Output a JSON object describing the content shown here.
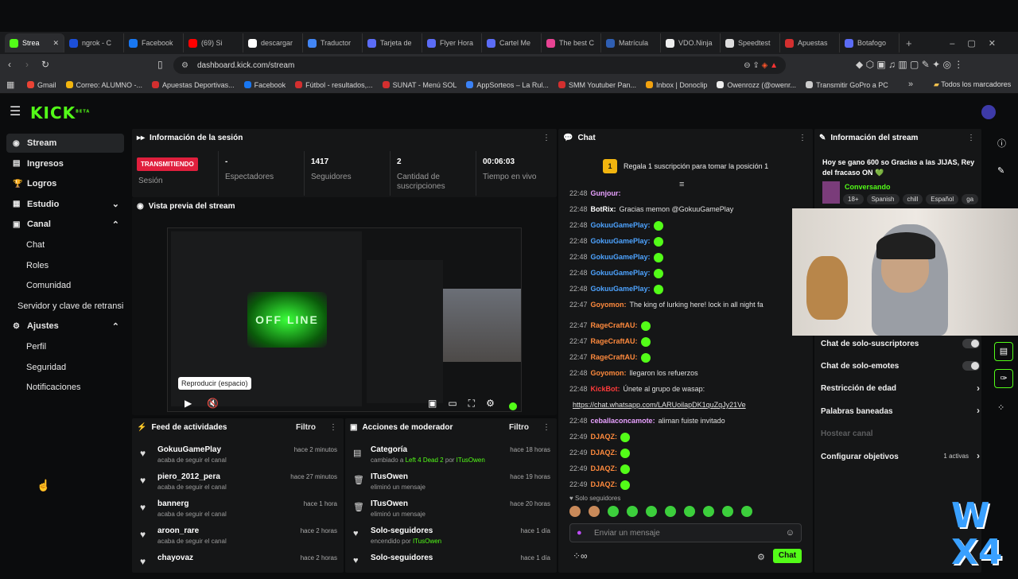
{
  "browser": {
    "tabs": [
      {
        "label": "Strea",
        "color": "#53fc18",
        "active": true
      },
      {
        "label": "ngrok - C",
        "color": "#1c4fd8"
      },
      {
        "label": "Facebook",
        "color": "#1877f2"
      },
      {
        "label": "(69) Si",
        "color": "#ff0000"
      },
      {
        "label": "descargar",
        "color": "#ffffff"
      },
      {
        "label": "Traductor",
        "color": "#4285f4"
      },
      {
        "label": "Tarjeta de",
        "color": "#5b6cf6"
      },
      {
        "label": "Flyer Hora",
        "color": "#5b6cf6"
      },
      {
        "label": "Cartel Me",
        "color": "#5b6cf6"
      },
      {
        "label": "The best C",
        "color": "#e84393"
      },
      {
        "label": "Matrícula",
        "color": "#2f5fb3"
      },
      {
        "label": "VDO.Ninja",
        "color": "#eeeeee"
      },
      {
        "label": "Speedtest",
        "color": "#dddddd"
      },
      {
        "label": "Apuestas",
        "color": "#d32f2f"
      },
      {
        "label": "Botafogo",
        "color": "#5b6cf6"
      }
    ],
    "url": "dashboard.kick.com/stream",
    "bookmarks": [
      {
        "label": "Gmail",
        "color": "#ea4335"
      },
      {
        "label": "Correo: ALUMNO -...",
        "color": "#f2b50f"
      },
      {
        "label": "Apuestas Deportivas...",
        "color": "#d32f2f"
      },
      {
        "label": "Facebook",
        "color": "#1877f2"
      },
      {
        "label": "Fútbol - resultados,...",
        "color": "#d32f2f"
      },
      {
        "label": "SUNAT - Menú SOL",
        "color": "#d32f2f"
      },
      {
        "label": "AppSorteos – La Rul...",
        "color": "#3b82f6"
      },
      {
        "label": "SMM Youtuber Pan...",
        "color": "#d32f2f"
      },
      {
        "label": "Inbox | Donoclip",
        "color": "#f2a20f"
      },
      {
        "label": "Owenrozz (@owenr...",
        "color": "#eeeeee"
      },
      {
        "label": "Transmitir GoPro a PC",
        "color": "#cccccc"
      }
    ],
    "bookmarks_all": "Todos los marcadores"
  },
  "kick": {
    "logo": "KICK",
    "beta": "BETA"
  },
  "sidebar": {
    "items": [
      {
        "label": "Stream",
        "icon": "stream-icon",
        "active": true
      },
      {
        "label": "Ingresos",
        "icon": "wallet-icon"
      },
      {
        "label": "Logros",
        "icon": "trophy-icon"
      },
      {
        "label": "Estudio",
        "icon": "studio-icon",
        "chev": "⌄"
      },
      {
        "label": "Canal",
        "icon": "channel-icon",
        "chev": "⌃"
      },
      {
        "label": "Chat",
        "sub": true
      },
      {
        "label": "Roles",
        "sub": true
      },
      {
        "label": "Comunidad",
        "sub": true
      },
      {
        "label": "Servidor y clave de retransi",
        "sub": true
      },
      {
        "label": "Ajustes",
        "icon": "gear-icon",
        "chev": "⌃"
      },
      {
        "label": "Perfil",
        "sub": true
      },
      {
        "label": "Seguridad",
        "sub": true
      },
      {
        "label": "Notificaciones",
        "sub": true
      }
    ]
  },
  "session": {
    "title": "Información de la sesión",
    "status": "TRANSMITIENDO",
    "status_label": "Sesión",
    "stats": [
      {
        "value": "-",
        "label": "Espectadores"
      },
      {
        "value": "1417",
        "label": "Seguidores"
      },
      {
        "value": "2",
        "label": "Cantidad de suscripciones"
      },
      {
        "value": "00:06:03",
        "label": "Tiempo en vivo"
      }
    ]
  },
  "preview": {
    "title": "Vista previa del stream",
    "tooltip": "Reproducir (espacio)",
    "offline": "OFF LINE"
  },
  "feed": {
    "title": "Feed de actividades",
    "filter": "Filtro",
    "rows": [
      {
        "name": "GokuuGamePlay",
        "sub": "acaba de seguir el canal",
        "time": "hace 2 minutos"
      },
      {
        "name": "piero_2012_pera",
        "sub": "acaba de seguir el canal",
        "time": "hace 27 minutos"
      },
      {
        "name": "bannerg",
        "sub": "acaba de seguir el canal",
        "time": "hace 1 hora"
      },
      {
        "name": "aroon_rare",
        "sub": "acaba de seguir el canal",
        "time": "hace 2 horas"
      },
      {
        "name": "chayovaz",
        "sub": "",
        "time": "hace 2 horas"
      }
    ]
  },
  "mod": {
    "title": "Acciones de moderador",
    "filter": "Filtro",
    "rows": [
      {
        "name": "Categoría",
        "sub": "cambiado a",
        "game": "Left 4 Dead 2",
        "by": "por",
        "user": "ITusOwen",
        "time": "hace 18 horas"
      },
      {
        "name": "ITusOwen",
        "sub": "eliminó un mensaje",
        "time": "hace 19 horas"
      },
      {
        "name": "ITusOwen",
        "sub": "eliminó un mensaje",
        "time": "hace 20 horas"
      },
      {
        "name": "Solo-seguidores",
        "sub": "encendido por",
        "user": "ITusOwen",
        "time": "hace 1 día"
      },
      {
        "name": "Solo-seguidores",
        "sub": "",
        "time": "hace 1 día"
      }
    ]
  },
  "chat": {
    "title": "Chat",
    "pinned": "Regala 1 suscripción para tomar la posición 1",
    "pinned_rank": "1",
    "messages": [
      {
        "time": "22:48",
        "user": "Gunjour:",
        "color": "#e8a1ff",
        "text": "",
        "emotes": 0
      },
      {
        "time": "22:48",
        "user": "BotRix:",
        "color": "#ffffff",
        "text": "Gracias memon @GokuuGamePlay",
        "emotes": 0
      },
      {
        "time": "22:48",
        "user": "GokuuGamePlay:",
        "color": "#4da3ff",
        "text": "",
        "emotes": 1
      },
      {
        "time": "22:48",
        "user": "GokuuGamePlay:",
        "color": "#4da3ff",
        "text": "",
        "emotes": 1
      },
      {
        "time": "22:48",
        "user": "GokuuGamePlay:",
        "color": "#4da3ff",
        "text": "",
        "emotes": 1
      },
      {
        "time": "22:48",
        "user": "GokuuGamePlay:",
        "color": "#4da3ff",
        "text": "",
        "emotes": 1
      },
      {
        "time": "22:48",
        "user": "GokuuGamePlay:",
        "color": "#4da3ff",
        "text": "",
        "emotes": 1
      },
      {
        "time": "22:47",
        "user": "Goyomon:",
        "color": "#ff8a3d",
        "text": "The king of lurking here! lock in all night fa",
        "emotes": 0
      },
      {
        "time": "22:47",
        "user": "RageCraftAU:",
        "color": "#ff8a3d",
        "text": "",
        "emotes": 1
      },
      {
        "time": "22:47",
        "user": "RageCraftAU:",
        "color": "#ff8a3d",
        "text": "",
        "emotes": 1
      },
      {
        "time": "22:47",
        "user": "RageCraftAU:",
        "color": "#ff8a3d",
        "text": "",
        "emotes": 1
      },
      {
        "time": "22:48",
        "user": "Goyomon:",
        "color": "#ff8a3d",
        "text": "llegaron los refuerzos",
        "emotes": 0
      },
      {
        "time": "22:48",
        "user": "KickBot:",
        "color": "#ff3b3b",
        "text": "Únete al grupo de wasap:",
        "emotes": 0
      },
      {
        "time": "",
        "user": "",
        "color": "#ffffff",
        "text": "https://chat.whatsapp.com/LARUoilapDK1quZqJy21Ve",
        "emotes": 0
      },
      {
        "time": "22:48",
        "user": "ceballaconcamote:",
        "color": "#e8a1ff",
        "text": "aliman fuiste invitado",
        "emotes": 0
      },
      {
        "time": "22:49",
        "user": "DJAQZ:",
        "color": "#ff8a3d",
        "text": "",
        "emotes": 1
      },
      {
        "time": "22:49",
        "user": "DJAQZ:",
        "color": "#ff8a3d",
        "text": "",
        "emotes": 1
      },
      {
        "time": "22:49",
        "user": "DJAQZ:",
        "color": "#ff8a3d",
        "text": "",
        "emotes": 1
      },
      {
        "time": "22:49",
        "user": "DJAQZ:",
        "color": "#ff8a3d",
        "text": "",
        "emotes": 1
      }
    ],
    "followers_only": "Solo seguidores",
    "placeholder": "Enviar un mensaje",
    "send": "Chat"
  },
  "info": {
    "title": "Información del stream",
    "stream_title": "Hoy se gano 600 so Gracias a las JIJAS, Rey del fracaso ON 💚",
    "category": "Conversando",
    "tags": [
      "18+",
      "Spanish",
      "chill",
      "Español",
      "ga"
    ],
    "settings": [
      {
        "label": "Chat de solo-suscriptores",
        "kind": "toggle"
      },
      {
        "label": "Chat de solo-emotes",
        "kind": "toggle"
      },
      {
        "label": "Restricción de edad",
        "kind": "chev"
      },
      {
        "label": "Palabras baneadas",
        "kind": "chev"
      },
      {
        "label": "Hostear canal",
        "kind": "none"
      },
      {
        "label": "Configurar objetivos",
        "kind": "chev",
        "badge": "1 activas"
      }
    ]
  },
  "overlay_text": "W X4"
}
